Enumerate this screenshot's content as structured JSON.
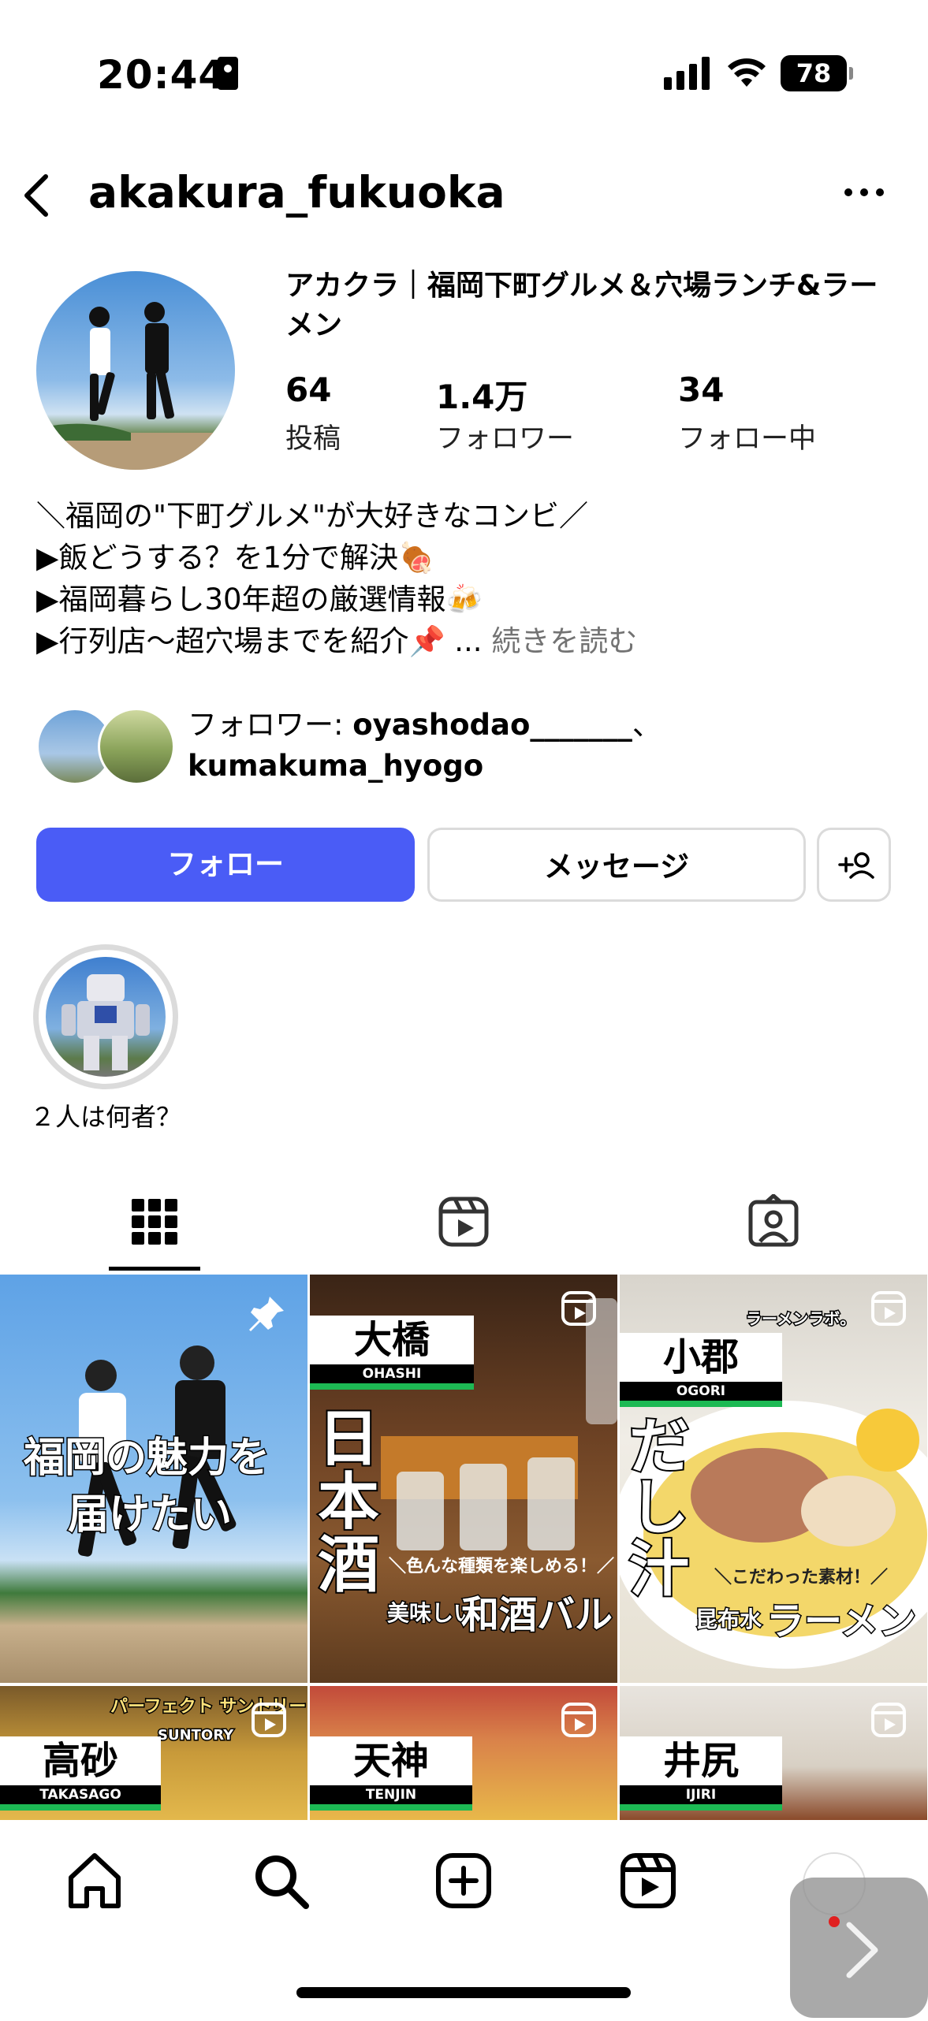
{
  "status_bar": {
    "time": "20:44",
    "battery": "78"
  },
  "header": {
    "username": "akakura_fukuoka"
  },
  "profile": {
    "display_name": "アカクラ｜福岡下町グルメ＆穴場ランチ&ラーメン",
    "stats": [
      {
        "value": "64",
        "label": "投稿"
      },
      {
        "value": "1.4万",
        "label": "フォロワー"
      },
      {
        "value": "34",
        "label": "フォロー中"
      }
    ],
    "bio": [
      "＼福岡の\"下町グルメ\"が大好きなコンビ／",
      "▶飯どうする？を1分で解決🍖",
      "▶福岡暮らし30年超の厳選情報🍻",
      "▶行列店〜超穴場までを紹介📌 ..."
    ],
    "bio_more": "続きを読む",
    "mutual": {
      "prefix": "フォロワー: ",
      "name1": "oyashodao_______",
      "separator": "、",
      "name2": "kumakuma_hyogo"
    }
  },
  "actions": {
    "follow": "フォロー",
    "message": "メッセージ"
  },
  "highlight": {
    "label": "２人は何者？"
  },
  "grid": {
    "tile1": {
      "caption_line1": "福岡の魅力を",
      "caption_line2": "届けたい"
    },
    "tile2": {
      "place_jp": "大橋",
      "place_en": "OHASHI",
      "big_text": [
        "日",
        "本",
        "酒"
      ],
      "sub": "＼色んな種類を楽しめる！／",
      "tagline_small": "美味しい",
      "tagline_big": "和酒バル"
    },
    "tile3": {
      "place_jp": "小郡",
      "place_en": "OGORI",
      "big_text": [
        "だ",
        "し",
        "汁"
      ],
      "sub": "＼こだわった素材！／",
      "tagline_small": "昆布水",
      "tagline_big": "ラーメン",
      "brand": "ラーメンラボ。"
    },
    "tile4": {
      "place_jp": "高砂",
      "place_en": "TAKASAGO",
      "sign": "パーフェクト サントリービール",
      "brand": "SUNTORY"
    },
    "tile5": {
      "place_jp": "天神",
      "place_en": "TENJIN"
    },
    "tile6": {
      "place_jp": "井尻",
      "place_en": "IJIRI"
    }
  }
}
